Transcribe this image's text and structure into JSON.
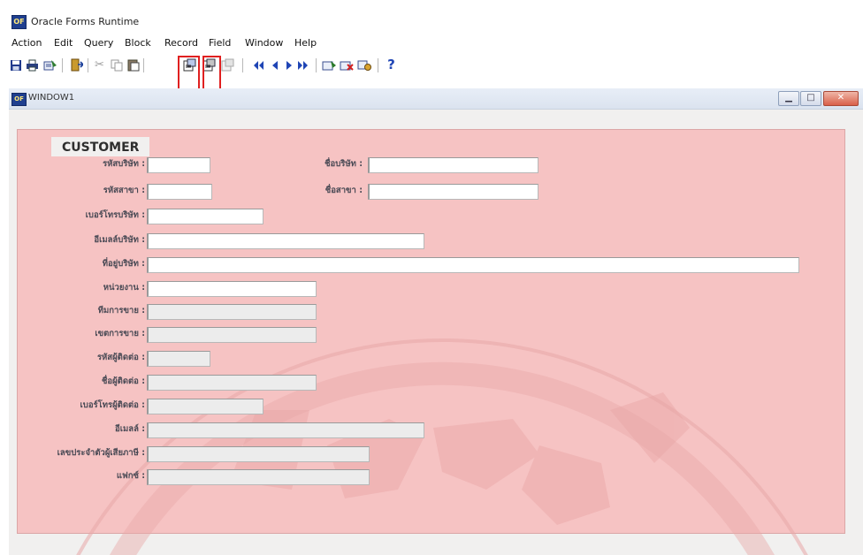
{
  "app": {
    "title": "Oracle Forms Runtime",
    "icon": "oracle-forms-icon"
  },
  "menu": [
    "Action",
    "Edit",
    "Query",
    "Block",
    "Record",
    "Field",
    "Window",
    "Help"
  ],
  "toolbar": {
    "annotations": [
      "2",
      "3"
    ],
    "help_glyph": "?",
    "highlight_color": "#e02020"
  },
  "window": {
    "title": "WINDOW1"
  },
  "panel": {
    "title": "CUSTOMER",
    "background": "#f6c3c3"
  },
  "form": {
    "company_code": {
      "label": "รหัสบริษัท :",
      "value": ""
    },
    "company_name": {
      "label": "ชื่อบริษัท :",
      "value": ""
    },
    "branch_code": {
      "label": "รหัสสาขา :",
      "value": ""
    },
    "branch_name": {
      "label": "ชื่อสาขา :",
      "value": ""
    },
    "company_phone": {
      "label": "เบอร์โทรบริษัท :",
      "value": ""
    },
    "company_email": {
      "label": "อีเมลล์บริษัท :",
      "value": ""
    },
    "company_address": {
      "label": "ที่อยู่บริษัท :",
      "value": ""
    },
    "department": {
      "label": "หน่วยงาน :",
      "value": ""
    },
    "sales_team": {
      "label": "ทีมการขาย :",
      "value": ""
    },
    "sales_zone": {
      "label": "เขตการขาย :",
      "value": ""
    },
    "contact_code": {
      "label": "รหัสผู้ติดต่อ :",
      "value": ""
    },
    "contact_name": {
      "label": "ชื่อผู้ติดต่อ :",
      "value": ""
    },
    "contact_phone": {
      "label": "เบอร์โทรผู้ติดต่อ :",
      "value": ""
    },
    "contact_email": {
      "label": "อีเมลล์ :",
      "value": ""
    },
    "tax_id": {
      "label": "เลขประจำตัวผู้เสียภาษี :",
      "value": ""
    },
    "fax": {
      "label": "แฟกซ์ :",
      "value": ""
    }
  }
}
